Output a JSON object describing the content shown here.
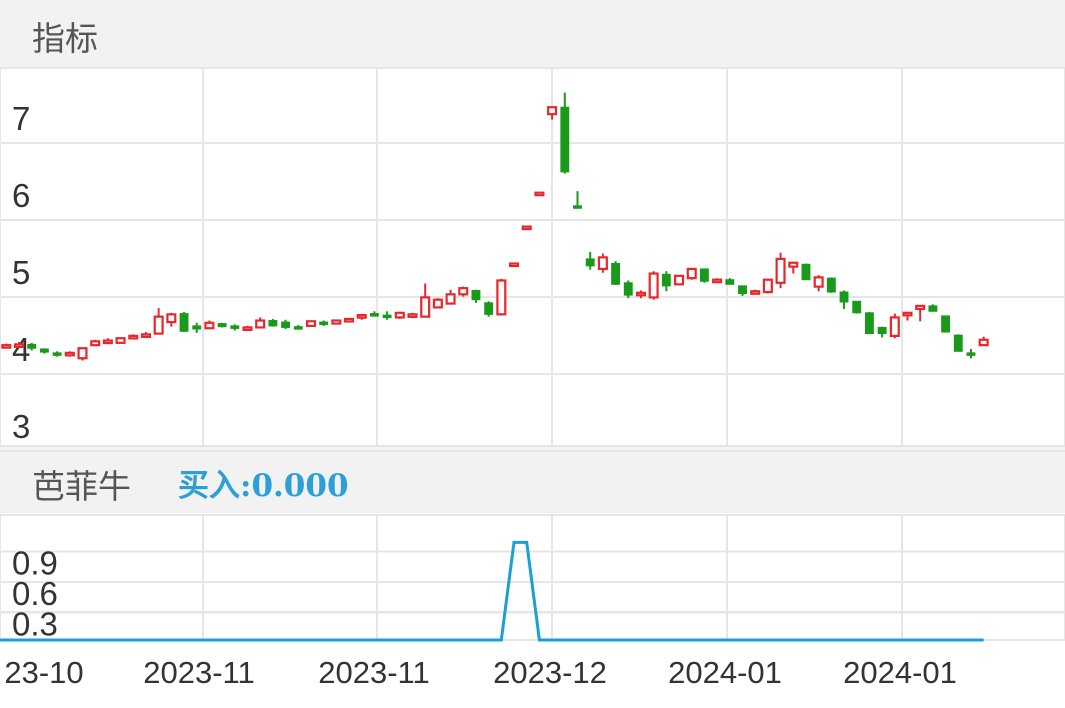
{
  "panels": {
    "top_label": "指标",
    "indicator_name": "芭菲牛",
    "indicator_value": "买入:0.000"
  },
  "colors": {
    "up": "#e8262b",
    "down": "#1a9a1a",
    "line": "#1a9fd6",
    "grid": "#e6e6e6"
  },
  "chart_data": [
    {
      "type": "candlestick",
      "ylim": [
        2.9,
        7.6
      ],
      "yticks": [
        3,
        4,
        5,
        6,
        7
      ],
      "xticks": [
        "23-10",
        "2023-11",
        "2023-11",
        "2023-12",
        "2024-01",
        "2024-01"
      ],
      "grid": true,
      "candles": [
        [
          4.05,
          4.07,
          4.03,
          4.05
        ],
        [
          4.06,
          4.09,
          4.04,
          4.06
        ],
        [
          4.06,
          4.08,
          3.98,
          4.01
        ],
        [
          4.0,
          4.01,
          3.94,
          3.96
        ],
        [
          3.95,
          3.97,
          3.9,
          3.94
        ],
        [
          3.94,
          3.97,
          3.9,
          3.95
        ],
        [
          3.88,
          4.01,
          3.85,
          4.01
        ],
        [
          4.05,
          4.12,
          4.05,
          4.1
        ],
        [
          4.11,
          4.14,
          4.08,
          4.11
        ],
        [
          4.08,
          4.15,
          4.07,
          4.14
        ],
        [
          4.15,
          4.19,
          4.13,
          4.17
        ],
        [
          4.17,
          4.22,
          4.15,
          4.19
        ],
        [
          4.2,
          4.53,
          4.2,
          4.42
        ],
        [
          4.35,
          4.47,
          4.29,
          4.45
        ],
        [
          4.46,
          4.48,
          4.22,
          4.23
        ],
        [
          4.3,
          4.34,
          4.21,
          4.26
        ],
        [
          4.27,
          4.37,
          4.26,
          4.34
        ],
        [
          4.33,
          4.34,
          4.28,
          4.29
        ],
        [
          4.3,
          4.32,
          4.24,
          4.27
        ],
        [
          4.27,
          4.3,
          4.25,
          4.28
        ],
        [
          4.28,
          4.41,
          4.28,
          4.37
        ],
        [
          4.37,
          4.39,
          4.29,
          4.3
        ],
        [
          4.35,
          4.38,
          4.26,
          4.28
        ],
        [
          4.29,
          4.31,
          4.27,
          4.28
        ],
        [
          4.3,
          4.37,
          4.29,
          4.36
        ],
        [
          4.35,
          4.37,
          4.3,
          4.33
        ],
        [
          4.33,
          4.38,
          4.32,
          4.37
        ],
        [
          4.37,
          4.4,
          4.36,
          4.39
        ],
        [
          4.41,
          4.44,
          4.38,
          4.44
        ],
        [
          4.46,
          4.49,
          4.42,
          4.45
        ],
        [
          4.44,
          4.49,
          4.38,
          4.41
        ],
        [
          4.41,
          4.48,
          4.39,
          4.47
        ],
        [
          4.42,
          4.47,
          4.4,
          4.45
        ],
        [
          4.42,
          4.85,
          4.42,
          4.67
        ],
        [
          4.54,
          4.66,
          4.53,
          4.64
        ],
        [
          4.59,
          4.77,
          4.58,
          4.71
        ],
        [
          4.71,
          4.81,
          4.68,
          4.79
        ],
        [
          4.76,
          4.77,
          4.6,
          4.64
        ],
        [
          4.6,
          4.62,
          4.42,
          4.45
        ],
        [
          4.45,
          4.91,
          4.45,
          4.89
        ],
        [
          5.11,
          5.11,
          5.1,
          5.11
        ],
        [
          5.59,
          5.59,
          5.58,
          5.59
        ],
        [
          6.03,
          6.04,
          6.02,
          6.03
        ],
        [
          7.05,
          7.14,
          6.98,
          7.14
        ],
        [
          7.14,
          7.33,
          6.28,
          6.3
        ],
        [
          5.86,
          6.05,
          5.84,
          5.85
        ],
        [
          5.17,
          5.26,
          5.03,
          5.08
        ],
        [
          5.04,
          5.24,
          4.99,
          5.19
        ],
        [
          5.11,
          5.14,
          4.83,
          4.84
        ],
        [
          4.86,
          4.89,
          4.66,
          4.7
        ],
        [
          4.72,
          4.76,
          4.66,
          4.73
        ],
        [
          4.67,
          5.01,
          4.64,
          4.98
        ],
        [
          4.97,
          5.01,
          4.75,
          4.82
        ],
        [
          4.84,
          4.96,
          4.83,
          4.95
        ],
        [
          4.92,
          5.05,
          4.9,
          5.04
        ],
        [
          5.04,
          5.04,
          4.86,
          4.88
        ],
        [
          4.88,
          4.92,
          4.87,
          4.9
        ],
        [
          4.9,
          4.92,
          4.84,
          4.84
        ],
        [
          4.82,
          4.82,
          4.69,
          4.72
        ],
        [
          4.72,
          4.77,
          4.71,
          4.75
        ],
        [
          4.74,
          4.9,
          4.72,
          4.9
        ],
        [
          4.86,
          5.25,
          4.79,
          5.17
        ],
        [
          5.07,
          5.13,
          4.98,
          5.12
        ],
        [
          5.1,
          5.11,
          4.9,
          4.9
        ],
        [
          4.81,
          4.96,
          4.75,
          4.93
        ],
        [
          4.92,
          4.93,
          4.73,
          4.74
        ],
        [
          4.74,
          4.76,
          4.52,
          4.61
        ],
        [
          4.62,
          4.62,
          4.46,
          4.47
        ],
        [
          4.47,
          4.48,
          4.2,
          4.2
        ],
        [
          4.28,
          4.29,
          4.15,
          4.2
        ],
        [
          4.17,
          4.46,
          4.14,
          4.41
        ],
        [
          4.44,
          4.47,
          4.37,
          4.47
        ],
        [
          4.52,
          4.56,
          4.36,
          4.56
        ],
        [
          4.56,
          4.58,
          4.49,
          4.49
        ],
        [
          4.43,
          4.43,
          4.22,
          4.22
        ],
        [
          4.18,
          4.19,
          3.97,
          3.97
        ],
        [
          3.95,
          4.0,
          3.88,
          3.92
        ],
        [
          4.05,
          4.16,
          4.05,
          4.12
        ]
      ]
    },
    {
      "type": "line",
      "ylim": [
        0,
        1.0
      ],
      "yticks": [
        0.3,
        0.6,
        0.9
      ],
      "series": [
        {
          "values": [
            0,
            0,
            0,
            0,
            0,
            0,
            0,
            0,
            0,
            0,
            0,
            0,
            0,
            0,
            0,
            0,
            0,
            0,
            0,
            0,
            0,
            0,
            0,
            0,
            0,
            0,
            0,
            0,
            0,
            0,
            0,
            0,
            0,
            0,
            0,
            0,
            0,
            0,
            0,
            0,
            0.95,
            0.95,
            0,
            0,
            0,
            0,
            0,
            0,
            0,
            0,
            0,
            0,
            0,
            0,
            0,
            0,
            0,
            0,
            0,
            0,
            0,
            0,
            0,
            0,
            0,
            0,
            0,
            0,
            0,
            0,
            0,
            0,
            0,
            0,
            0,
            0,
            0,
            0
          ]
        }
      ]
    }
  ]
}
